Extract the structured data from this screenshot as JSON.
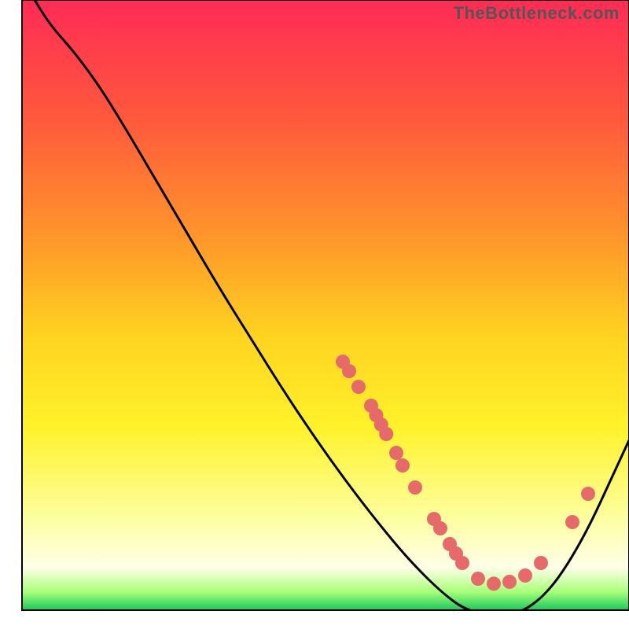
{
  "watermark": "TheBottleneck.com",
  "chart_data": {
    "type": "line",
    "title": "",
    "xlabel": "",
    "ylabel": "",
    "xlim": [
      0,
      100
    ],
    "ylim": [
      0,
      100
    ],
    "background_gradient": {
      "stops": [
        {
          "offset": 0,
          "color": "#ff2b55"
        },
        {
          "offset": 20,
          "color": "#ff5a3c"
        },
        {
          "offset": 40,
          "color": "#ff9a2a"
        },
        {
          "offset": 55,
          "color": "#ffd321"
        },
        {
          "offset": 70,
          "color": "#fff22a"
        },
        {
          "offset": 85,
          "color": "#fdffa0"
        },
        {
          "offset": 93,
          "color": "#ffffe8"
        },
        {
          "offset": 97,
          "color": "#a9ff7a"
        },
        {
          "offset": 100,
          "color": "#18c95a"
        }
      ]
    },
    "series": [
      {
        "name": "bottleneck-curve",
        "color": "#000000",
        "points": [
          {
            "x": 5.5,
            "y": 100.0
          },
          {
            "x": 8.0,
            "y": 96.0
          },
          {
            "x": 12.0,
            "y": 91.5
          },
          {
            "x": 16.0,
            "y": 86.0
          },
          {
            "x": 20.0,
            "y": 79.5
          },
          {
            "x": 25.0,
            "y": 71.0
          },
          {
            "x": 30.0,
            "y": 62.5
          },
          {
            "x": 35.0,
            "y": 54.0
          },
          {
            "x": 40.0,
            "y": 46.0
          },
          {
            "x": 45.0,
            "y": 38.0
          },
          {
            "x": 50.0,
            "y": 30.5
          },
          {
            "x": 55.0,
            "y": 23.5
          },
          {
            "x": 60.0,
            "y": 17.0
          },
          {
            "x": 65.0,
            "y": 11.0
          },
          {
            "x": 70.0,
            "y": 6.0
          },
          {
            "x": 74.0,
            "y": 3.0
          },
          {
            "x": 78.0,
            "y": 2.2
          },
          {
            "x": 82.0,
            "y": 2.4
          },
          {
            "x": 85.0,
            "y": 4.0
          },
          {
            "x": 88.0,
            "y": 7.0
          },
          {
            "x": 91.0,
            "y": 11.5
          },
          {
            "x": 94.0,
            "y": 17.0
          },
          {
            "x": 97.0,
            "y": 23.5
          },
          {
            "x": 100.0,
            "y": 30.0
          }
        ]
      }
    ],
    "highlight_dots": {
      "color": "#e66a6a",
      "radius": 9,
      "points": [
        {
          "x": 54.5,
          "y": 42.5
        },
        {
          "x": 55.5,
          "y": 41.0
        },
        {
          "x": 57.0,
          "y": 38.5
        },
        {
          "x": 59.0,
          "y": 35.5
        },
        {
          "x": 59.8,
          "y": 34.0
        },
        {
          "x": 60.6,
          "y": 32.5
        },
        {
          "x": 61.4,
          "y": 31.0
        },
        {
          "x": 63.0,
          "y": 28.0
        },
        {
          "x": 64.0,
          "y": 26.0
        },
        {
          "x": 66.0,
          "y": 22.5
        },
        {
          "x": 69.0,
          "y": 17.5
        },
        {
          "x": 70.0,
          "y": 16.0
        },
        {
          "x": 71.5,
          "y": 13.5
        },
        {
          "x": 72.5,
          "y": 12.0
        },
        {
          "x": 73.5,
          "y": 10.5
        },
        {
          "x": 76.0,
          "y": 8.0
        },
        {
          "x": 78.5,
          "y": 7.2
        },
        {
          "x": 81.0,
          "y": 7.5
        },
        {
          "x": 83.5,
          "y": 8.5
        },
        {
          "x": 86.0,
          "y": 10.5
        },
        {
          "x": 91.0,
          "y": 17.0
        },
        {
          "x": 93.5,
          "y": 21.5
        }
      ]
    },
    "frame": {
      "x0": 3.5,
      "y0": 3.0,
      "x1": 100.0,
      "y1": 100.0,
      "stroke": "#000000",
      "width": 2
    }
  }
}
